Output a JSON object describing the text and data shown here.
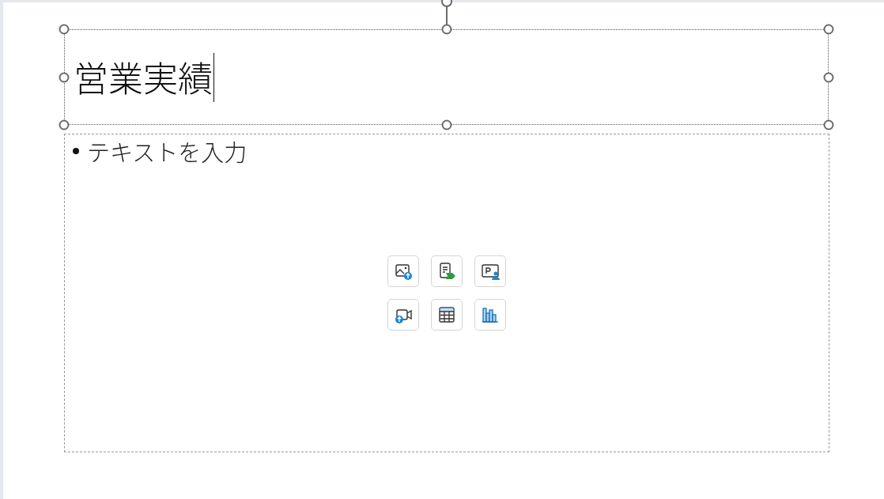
{
  "title_box": {
    "text": "営業実績",
    "editing": true,
    "selected": true
  },
  "content_box": {
    "placeholder": "テキストを入力"
  },
  "insert_buttons": [
    {
      "kind": "picture"
    },
    {
      "kind": "document"
    },
    {
      "kind": "presenter"
    },
    {
      "kind": "video"
    },
    {
      "kind": "table"
    },
    {
      "kind": "chart"
    }
  ]
}
